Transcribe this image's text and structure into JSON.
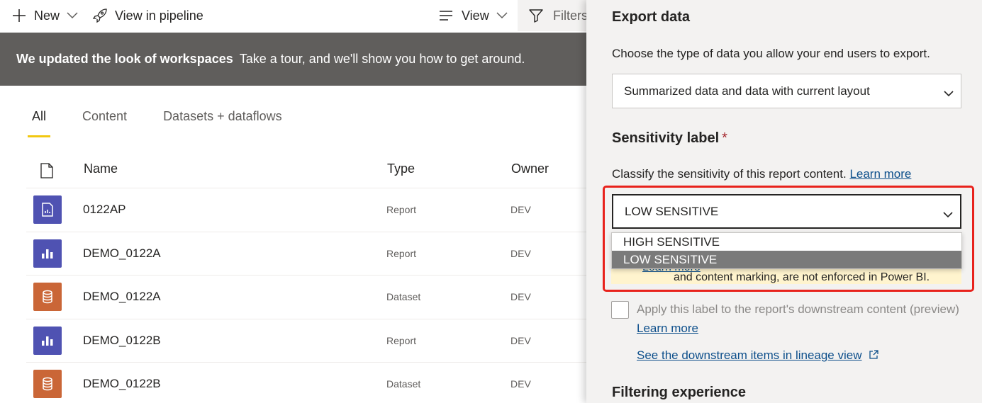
{
  "toolbar": {
    "new_label": "New",
    "pipeline_label": "View in pipeline",
    "view_label": "View",
    "filters_label": "Filters"
  },
  "banner": {
    "title": "We updated the look of workspaces",
    "text": "Take a tour, and we'll show you how to get around."
  },
  "tabs": [
    {
      "label": "All",
      "active": true
    },
    {
      "label": "Content",
      "active": false
    },
    {
      "label": "Datasets + dataflows",
      "active": false
    }
  ],
  "table": {
    "columns": {
      "name": "Name",
      "type": "Type",
      "owner": "Owner"
    },
    "rows": [
      {
        "icon": "report-page-icon",
        "name": "0122AP",
        "type": "Report",
        "owner": "DEV"
      },
      {
        "icon": "report-chart-icon",
        "name": "DEMO_0122A",
        "type": "Report",
        "owner": "DEV"
      },
      {
        "icon": "dataset-icon",
        "name": "DEMO_0122A",
        "type": "Dataset",
        "owner": "DEV"
      },
      {
        "icon": "report-chart-icon",
        "name": "DEMO_0122B",
        "type": "Report",
        "owner": "DEV"
      },
      {
        "icon": "dataset-icon",
        "name": "DEMO_0122B",
        "type": "Dataset",
        "owner": "DEV"
      }
    ]
  },
  "panel": {
    "export": {
      "heading": "Export data",
      "description": "Choose the type of data you allow your end users to export.",
      "selected": "Summarized data and data with current layout"
    },
    "sensitivity": {
      "heading": "Sensitivity label",
      "required_mark": "*",
      "description": "Classify the sensitivity of this report content.",
      "learn_more": "Learn more",
      "selected": "LOW SENSITIVE",
      "options": [
        "HIGH SENSITIVE",
        "LOW SENSITIVE"
      ],
      "notice_text": "and content marking, are not enforced in Power BI.",
      "notice_link": "Learn more"
    },
    "downstream": {
      "checkbox_label": "Apply this label to the report's downstream content (preview)",
      "learn_more": "Learn more",
      "lineage_link": "See the downstream items in lineage view"
    },
    "filtering": {
      "heading": "Filtering experience"
    }
  },
  "colors": {
    "banner_bg": "#605e5c",
    "tab_accent": "#f2c811",
    "report_icon_bg": "#4f52b2",
    "dataset_icon_bg": "#ca6637",
    "highlight_box": "#e8221c",
    "link": "#0d4f8b"
  }
}
